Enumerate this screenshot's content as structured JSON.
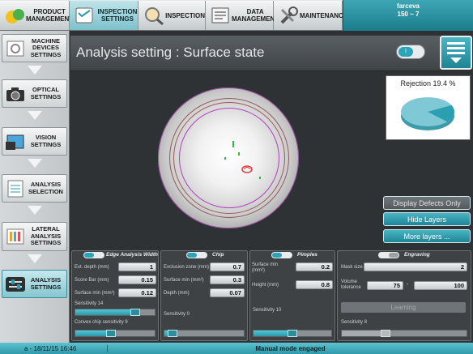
{
  "topnav": {
    "tabs": [
      {
        "label": "PRODUCT MANAGEMENT",
        "icon": "product-icon"
      },
      {
        "label": "INSPECTION SETTINGS",
        "icon": "inspection-settings-icon"
      },
      {
        "label": "INSPECTION",
        "icon": "inspection-icon"
      },
      {
        "label": "DATA MANAGEMENT",
        "icon": "data-icon"
      },
      {
        "label": "MAINTENANCE",
        "icon": "maintenance-icon"
      }
    ],
    "user": {
      "name": "farceva",
      "value": "150 ~ 7"
    }
  },
  "sidebar": {
    "items": [
      {
        "label": "MACHINE DEVICES SETTINGS"
      },
      {
        "label": "OPTICAL SETTINGS"
      },
      {
        "label": "VISION SETTINGS"
      },
      {
        "label": "ANALYSIS SELECTION"
      },
      {
        "label": "LATERAL ANALYSIS SETTINGS"
      },
      {
        "label": "ANALYSIS SETTINGS"
      }
    ]
  },
  "header": {
    "title": "Analysis setting : Surface state",
    "toggle_label": "I"
  },
  "rejection": {
    "label": "Rejection 19.4 %",
    "percent": 19.4,
    "colors": {
      "main": "#7fc9d6",
      "slice": "#2b9fb0"
    }
  },
  "actions": {
    "display_defects": "Display Defects Only",
    "hide_layers": "Hide Layers",
    "more_layers": "More layers ..."
  },
  "panels": {
    "edge": {
      "title": "Edge Analysis Width",
      "toggle": "I",
      "fields": [
        {
          "label": "Ext. depth (mm)",
          "value": "1"
        },
        {
          "label": "Score Bar (mm)",
          "value": "0.15"
        },
        {
          "label": "Surface min (mm²)",
          "value": "0.12"
        }
      ],
      "sensitivity_label": "Sensitivity 14",
      "sensitivity_value": 0.75,
      "convex_label": "Convex chip sensitivity 9",
      "convex_value": 0.45
    },
    "chip": {
      "title": "Chip",
      "toggle": "I",
      "fields": [
        {
          "label": "Exclusion zone (mm)",
          "value": "0.7"
        },
        {
          "label": "Surface min (mm²)",
          "value": "0.3"
        },
        {
          "label": "Depth (mm)",
          "value": "0.07"
        }
      ],
      "sensitivity_label": "Sensitivity 0",
      "sensitivity_value": 0.1
    },
    "pimples": {
      "title": "Pimples",
      "toggle": "I",
      "fields": [
        {
          "label": "Surface min (mm²)",
          "value": "0.2"
        },
        {
          "label": "Height (mm)",
          "value": "0.8"
        }
      ],
      "sensitivity_label": "Sensitivity 10",
      "sensitivity_value": 0.5
    },
    "engraving": {
      "title": "Engraving",
      "toggle": "O",
      "mask_label": "Mask size",
      "mask_value": "2",
      "volume_label": "Volume tolerance",
      "volume_min": "75",
      "volume_max": "100",
      "learning_label": "Learning",
      "sensitivity_label": "Sensitivity 8",
      "sensitivity_value": 0.35
    }
  },
  "status": {
    "date": "a - 18/11/15 16:46",
    "mode": "Manual mode engaged"
  }
}
